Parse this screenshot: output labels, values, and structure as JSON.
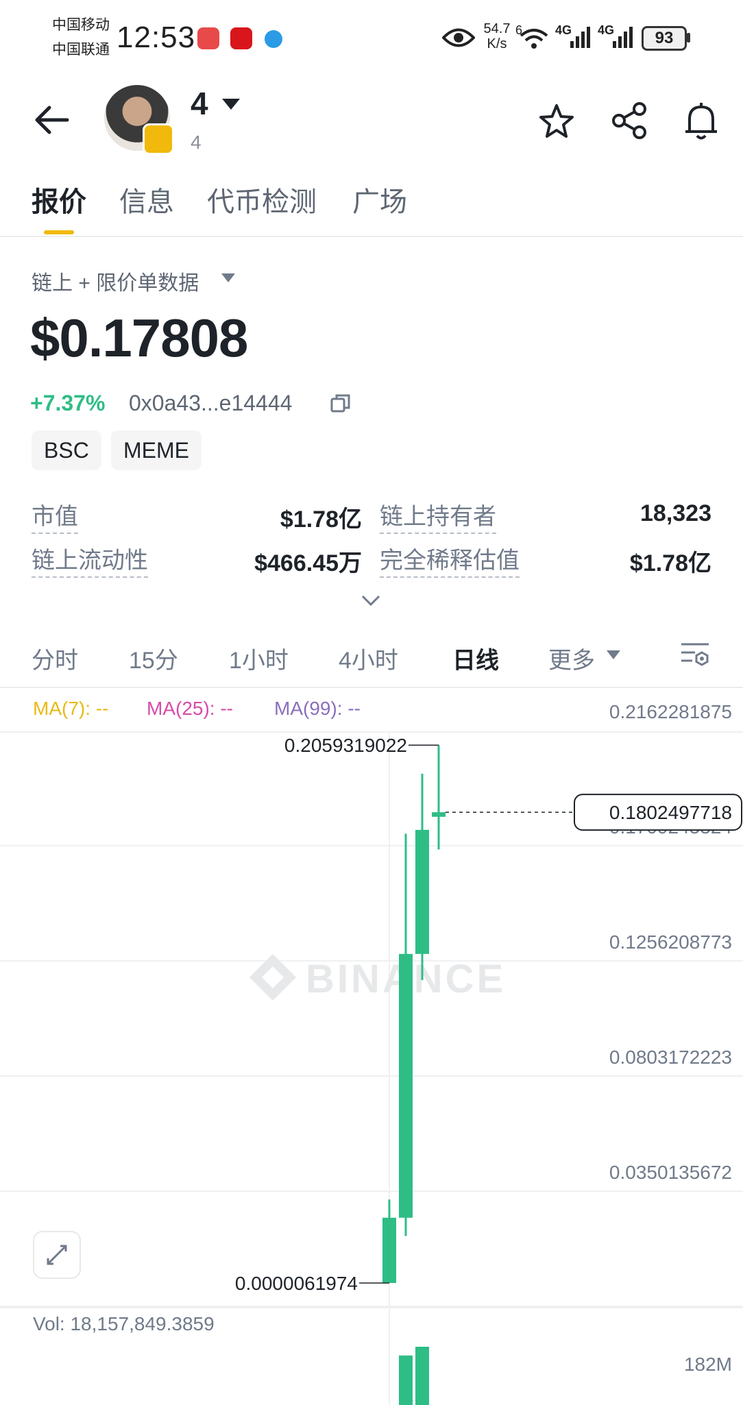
{
  "status_bar": {
    "carrier_1": "中国移动",
    "carrier_2": "中国联通",
    "time": "12:53",
    "net_speed_value": "54.7",
    "net_speed_unit": "K/s",
    "wifi_index": "6",
    "sig1": "4G",
    "sig2": "4G",
    "battery": "93",
    "app_icons": [
      "huawei-app-icon",
      "red-app-icon",
      "blue-app-icon"
    ]
  },
  "header": {
    "token_name": "4",
    "token_sub": "4",
    "icons": [
      "back-arrow-icon",
      "star-icon",
      "share-icon",
      "bell-icon"
    ]
  },
  "tabs": [
    {
      "label": "报价",
      "active": true
    },
    {
      "label": "信息",
      "active": false
    },
    {
      "label": "代币检测",
      "active": false
    },
    {
      "label": "广场",
      "active": false
    }
  ],
  "quote": {
    "source_label": "链上 + 限价单数据",
    "price": "$0.17808",
    "change": "+7.37%",
    "address": "0x0a43...e14444",
    "chips": [
      "BSC",
      "MEME"
    ]
  },
  "stats": [
    {
      "label": "市值",
      "value": "$1.78亿"
    },
    {
      "label": "链上持有者",
      "value": "18,323"
    },
    {
      "label": "链上流动性",
      "value": "$466.45万"
    },
    {
      "label": "完全稀释估值",
      "value": "$1.78亿"
    }
  ],
  "timeframes": [
    {
      "label": "分时",
      "active": false
    },
    {
      "label": "15分",
      "active": false
    },
    {
      "label": "1小时",
      "active": false
    },
    {
      "label": "4小时",
      "active": false
    },
    {
      "label": "日线",
      "active": true
    },
    {
      "label": "更多",
      "active": false
    }
  ],
  "ma": [
    {
      "label": "MA(7): --",
      "color": "#e8b917"
    },
    {
      "label": "MA(25): --",
      "color": "#d64ca8"
    },
    {
      "label": "MA(99): --",
      "color": "#8a6fbd"
    }
  ],
  "chart_data": {
    "type": "candlestick",
    "title": "",
    "y_axis_labels": [
      "0.2162281875",
      "0.1709245324",
      "0.1256208773",
      "0.0803172223",
      "0.0350135672"
    ],
    "ylim": [
      6.1974e-06,
      0.2162281875
    ],
    "current_price": "0.1802497718",
    "high_label": "0.2059319022",
    "low_label": "0.0000061974",
    "candles": [
      {
        "open": 6.1974e-06,
        "close": 0.025,
        "high": 0.032,
        "low": 6.1974e-06
      },
      {
        "open": 0.025,
        "close": 0.126,
        "high": 0.172,
        "low": 0.018
      },
      {
        "open": 0.126,
        "close": 0.1735,
        "high": 0.195,
        "low": 0.116
      },
      {
        "open": 0.1785,
        "close": 0.1802497718,
        "high": 0.2059319022,
        "low": 0.166
      }
    ],
    "color_up": "#2ebd85",
    "watermark": "BINANCE",
    "volume_label": "Vol: 18,157,849.3859",
    "volume_axis_label": "182M",
    "volumes_m": [
      0,
      85,
      100,
      0
    ]
  }
}
